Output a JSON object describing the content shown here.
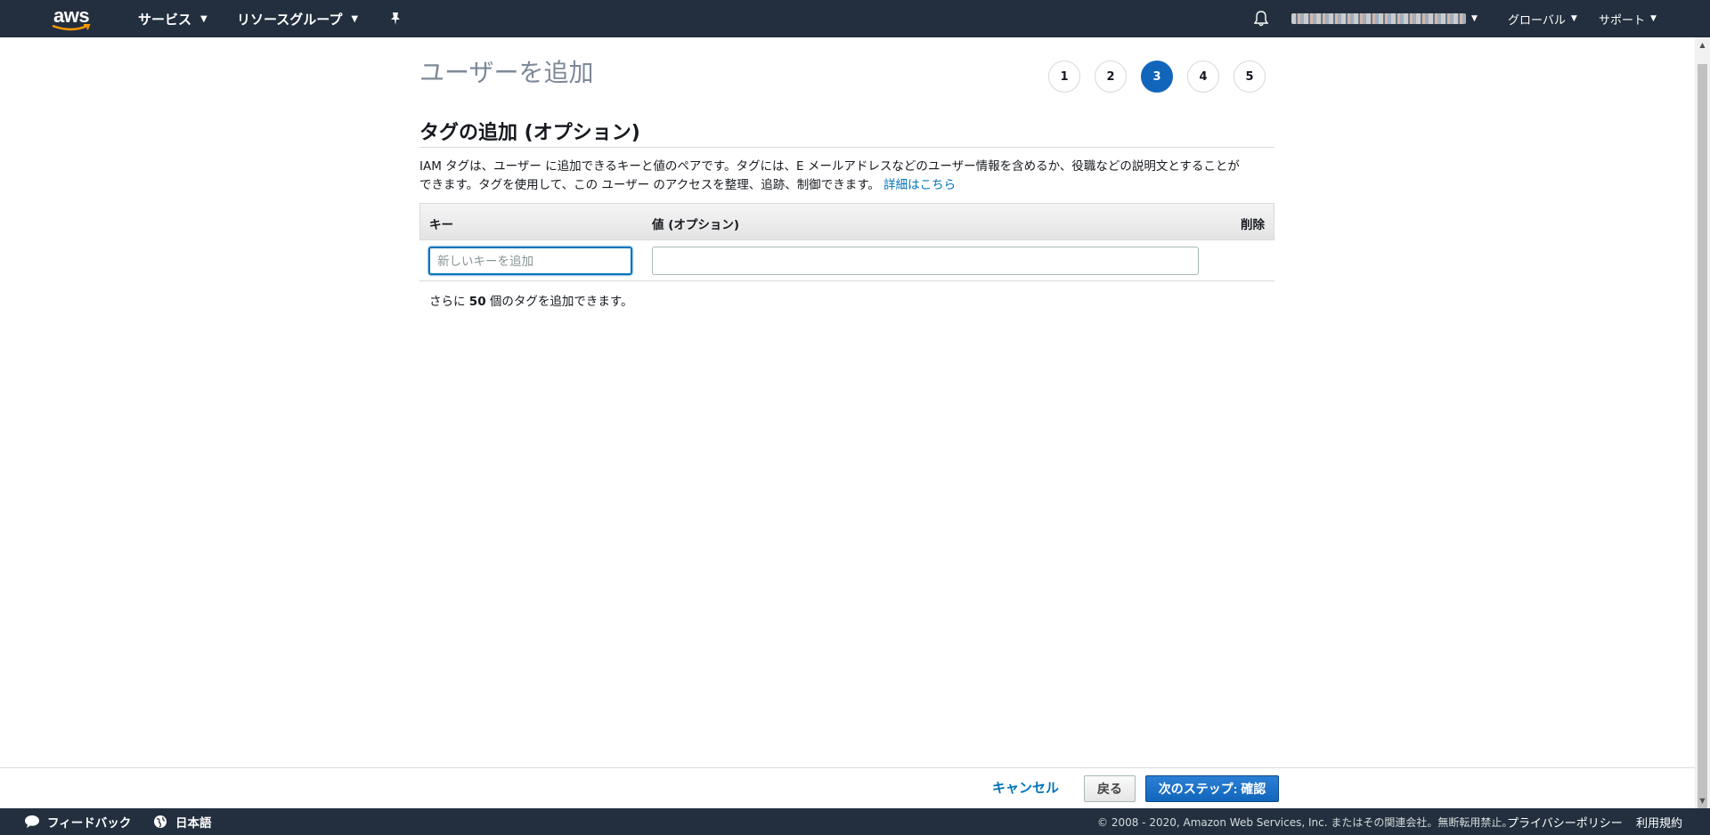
{
  "topnav": {
    "logo_text": "aws",
    "services": "サービス",
    "resource_groups": "リソースグループ",
    "region": "グローバル",
    "support": "サポート"
  },
  "page": {
    "title": "ユーザーを追加",
    "steps": [
      "1",
      "2",
      "3",
      "4",
      "5"
    ],
    "active_step": 3
  },
  "tags_section": {
    "title": "タグの追加 (オプション)",
    "desc_line1": "IAM タグは、ユーザー に追加できるキーと値のペアです。タグには、E メールアドレスなどのユーザー情報を含めるか、役職などの説明文とすることが",
    "desc_line2": "できます。タグを使用して、この ユーザー のアクセスを整理、追跡、制御できます。",
    "learn_more": "詳細はこちら",
    "col_key": "キー",
    "col_value": "値 (オプション)",
    "col_delete": "削除",
    "key_placeholder": "新しいキーを追加",
    "key_value": "",
    "value_value": "",
    "remaining_prefix": "さらに",
    "remaining_count": "50",
    "remaining_suffix": "個のタグを追加できます。"
  },
  "actions": {
    "cancel": "キャンセル",
    "back": "戻る",
    "next": "次のステップ: 確認"
  },
  "footer": {
    "feedback": "フィードバック",
    "language": "日本語",
    "copyright": "© 2008 - 2020, Amazon Web Services, Inc. またはその関連会社。無断転用禁止。",
    "privacy": "プライバシーポリシー",
    "terms": "利用規約"
  },
  "colors": {
    "nav_bg": "#232f3e",
    "accent_blue": "#0073bb",
    "step_active": "#1166bb"
  }
}
